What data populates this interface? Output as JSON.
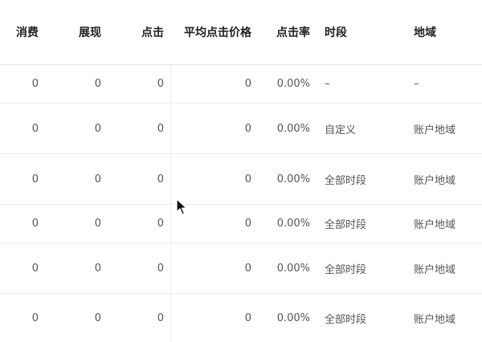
{
  "columns": {
    "spend": "消费",
    "impressions": "展现",
    "clicks": "点击",
    "avg_click_price": "平均点击价格",
    "ctr": "点击率",
    "time_slot": "时段",
    "region": "地域"
  },
  "rows": [
    {
      "spend": "0",
      "impressions": "0",
      "clicks": "0",
      "avg_click_price": "0",
      "ctr": "0.00%",
      "time_slot": "–",
      "region": "–"
    },
    {
      "spend": "0",
      "impressions": "0",
      "clicks": "0",
      "avg_click_price": "0",
      "ctr": "0.00%",
      "time_slot": "自定义",
      "region": "账户地域"
    },
    {
      "spend": "0",
      "impressions": "0",
      "clicks": "0",
      "avg_click_price": "0",
      "ctr": "0.00%",
      "time_slot": "全部时段",
      "region": "账户地域"
    },
    {
      "spend": "0",
      "impressions": "0",
      "clicks": "0",
      "avg_click_price": "0",
      "ctr": "0.00%",
      "time_slot": "全部时段",
      "region": "账户地域"
    },
    {
      "spend": "0",
      "impressions": "0",
      "clicks": "0",
      "avg_click_price": "0",
      "ctr": "0.00%",
      "time_slot": "全部时段",
      "region": "账户地域"
    },
    {
      "spend": "0",
      "impressions": "0",
      "clicks": "0",
      "avg_click_price": "0",
      "ctr": "0.00%",
      "time_slot": "全部时段",
      "region": "账户地域"
    }
  ]
}
